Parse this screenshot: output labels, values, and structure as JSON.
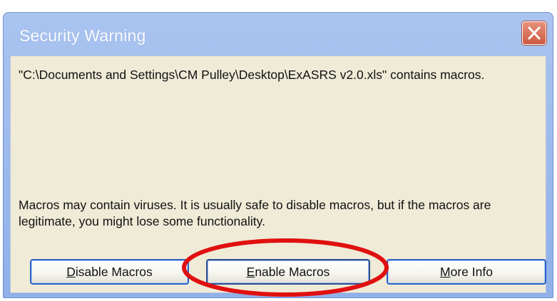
{
  "dialog": {
    "title": "Security Warning",
    "close_icon": "close-icon",
    "message_file": "\"C:\\Documents and Settings\\CM Pulley\\Desktop\\ExASRS v2.0.xls\" contains macros.",
    "message_warning": "Macros may contain viruses. It is usually safe to disable macros, but if the macros are legitimate, you might lose some functionality."
  },
  "buttons": {
    "disable": {
      "accel": "D",
      "rest": "isable Macros"
    },
    "enable": {
      "accel": "E",
      "rest": "nable Macros"
    },
    "more_info": {
      "accel": "M",
      "rest": "ore Info"
    }
  },
  "colors": {
    "title_bar": "#9ab8ee",
    "body_background": "#efebd7",
    "close_button": "#d8694f",
    "button_border": "#2a63c8",
    "annotation_circle": "#e01010"
  }
}
